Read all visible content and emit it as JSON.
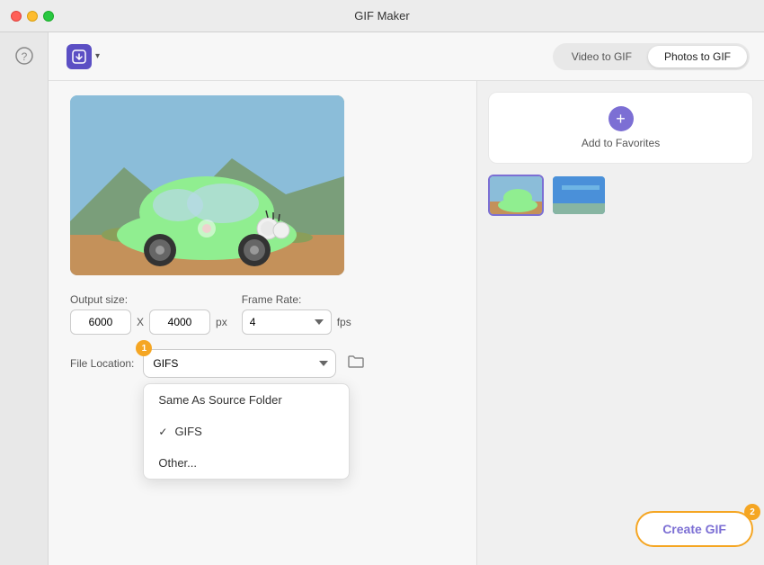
{
  "window": {
    "title": "GIF Maker"
  },
  "toolbar": {
    "mode_video_label": "Video to GIF",
    "mode_photos_label": "Photos to GIF",
    "active_mode": "Photos to GIF"
  },
  "output_settings": {
    "size_label": "Output size:",
    "width": "6000",
    "height": "4000",
    "px_label": "px",
    "x_label": "X",
    "framerate_label": "Frame Rate:",
    "framerate_value": "4",
    "fps_label": "fps"
  },
  "file_location": {
    "label": "File Location:",
    "selected": "GIFS",
    "options": [
      "Same As Source Folder",
      "GIFS",
      "Other..."
    ]
  },
  "dropdown": {
    "items": [
      {
        "label": "Same As Source Folder",
        "checked": false
      },
      {
        "label": "GIFS",
        "checked": true
      },
      {
        "label": "Other...",
        "checked": false
      }
    ]
  },
  "favorites": {
    "add_label": "Add to Favorites"
  },
  "buttons": {
    "create_gif": "Create GIF"
  },
  "badges": {
    "badge1": "1",
    "badge2": "2"
  }
}
